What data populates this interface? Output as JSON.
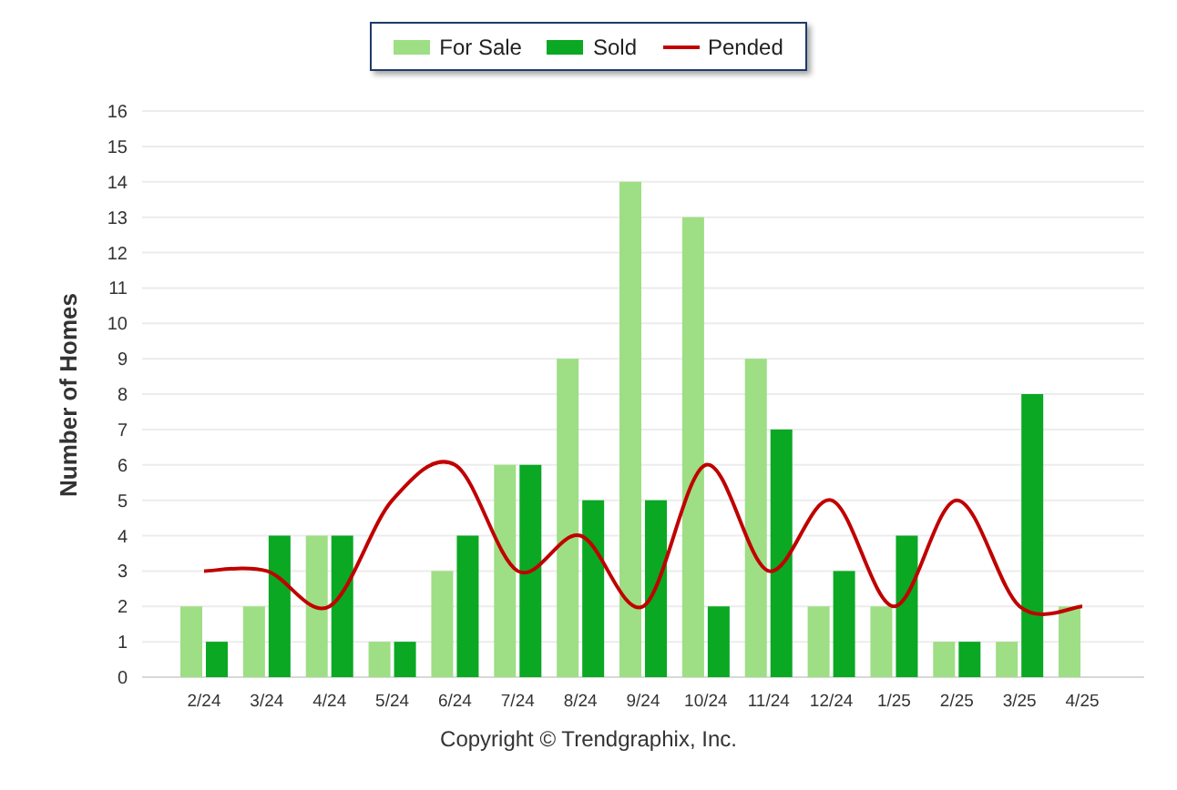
{
  "chart_data": {
    "type": "bar",
    "ylabel": "Number of Homes",
    "categories": [
      "2/24",
      "3/24",
      "4/24",
      "5/24",
      "6/24",
      "7/24",
      "8/24",
      "9/24",
      "10/24",
      "11/24",
      "12/24",
      "1/25",
      "2/25",
      "3/25",
      "4/25"
    ],
    "series": [
      {
        "name": "For Sale",
        "color": "#9ede85",
        "values": [
          2,
          2,
          4,
          1,
          3,
          6,
          9,
          14,
          13,
          9,
          2,
          2,
          1,
          1,
          2
        ]
      },
      {
        "name": "Sold",
        "color": "#0aa823",
        "values": [
          1,
          4,
          4,
          1,
          4,
          6,
          5,
          5,
          2,
          7,
          3,
          4,
          1,
          8,
          null
        ]
      },
      {
        "name": "Pended",
        "type": "line",
        "color": "#c00000",
        "values": [
          3,
          3,
          2,
          5,
          6,
          3,
          4,
          2,
          6,
          3,
          5,
          2,
          5,
          2,
          2
        ]
      }
    ],
    "grid": true,
    "ylim": [
      0,
      16
    ],
    "yticks": [
      0,
      1,
      2,
      3,
      4,
      5,
      6,
      7,
      8,
      9,
      10,
      11,
      12,
      13,
      14,
      15,
      16
    ]
  },
  "footer": {
    "copyright": "Copyright © Trendgraphix, Inc."
  }
}
